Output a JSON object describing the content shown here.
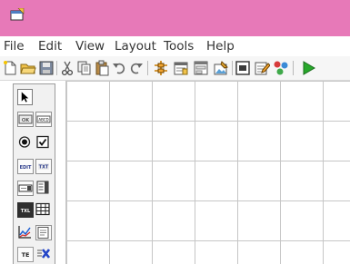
{
  "window": {
    "title": ""
  },
  "menu": [
    "File",
    "Edit",
    "View",
    "Layout",
    "Tools",
    "Help"
  ],
  "toolbar": {
    "icons": [
      "new-file-icon",
      "open-folder-icon",
      "save-icon",
      "cut-icon",
      "copy-icon",
      "paste-icon",
      "undo-icon",
      "redo-icon",
      "grid-align-icon",
      "properties-icon",
      "form-edit-icon",
      "edit-image-icon",
      "screenshot-icon",
      "document-edit-icon",
      "components-icon",
      "run-icon"
    ]
  },
  "palette": {
    "tools": [
      {
        "name": "pointer-tool",
        "label": ""
      },
      {
        "name": "button-tool",
        "label": "OK"
      },
      {
        "name": "textbox-tool",
        "label": "ABCD"
      },
      {
        "name": "radio-tool",
        "label": ""
      },
      {
        "name": "checkbox-tool",
        "label": ""
      },
      {
        "name": "edit-tool",
        "label": "EDIT"
      },
      {
        "name": "text-tool",
        "label": "TXT"
      },
      {
        "name": "combo-tool",
        "label": ""
      },
      {
        "name": "list-tool",
        "label": ""
      },
      {
        "name": "label-tool",
        "label": "TXL"
      },
      {
        "name": "table-tool",
        "label": ""
      },
      {
        "name": "chart-tool",
        "label": ""
      },
      {
        "name": "image-tool",
        "label": ""
      },
      {
        "name": "text-field-tool",
        "label": "TE"
      },
      {
        "name": "delete-tool",
        "label": ""
      }
    ]
  },
  "colors": {
    "titlebar": "#e779b8",
    "run": "#27a82b",
    "grid_line": "#c6c6c6"
  }
}
